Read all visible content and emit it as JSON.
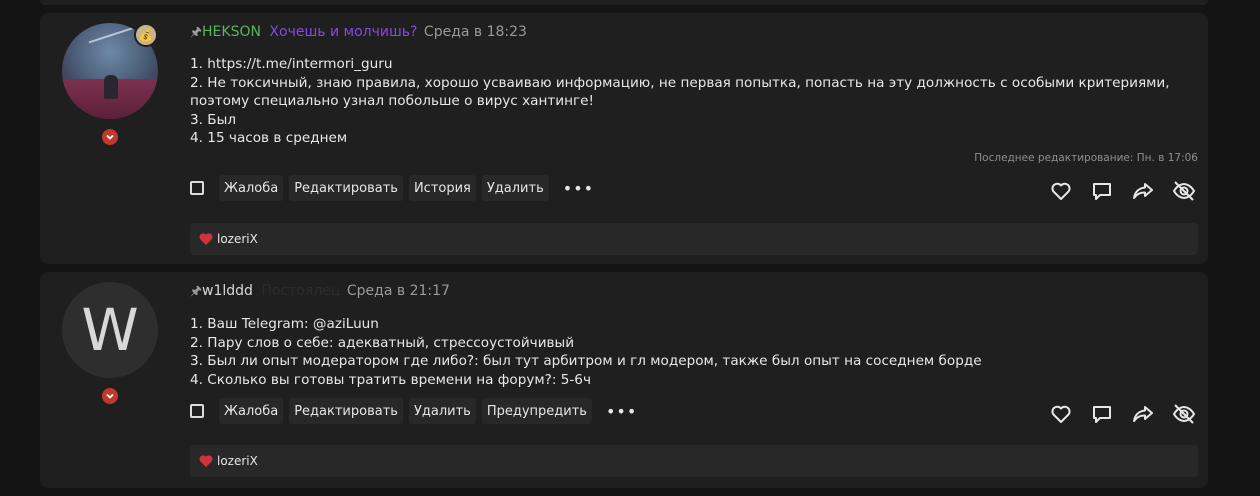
{
  "colors": {
    "accent_red": "#c0392b",
    "username_green": "#5ab55e",
    "title_purple": "#8b46e8"
  },
  "posts": [
    {
      "username": "HEKSON",
      "user_title": "Хочешь и молчишь?",
      "date": "Среда в 18:23",
      "avatar_letter": "",
      "lines": [
        "1. https://t.me/intermori_guru",
        "2. Не токсичный, знаю правила, хорошо усваиваю информацию, не первая попытка, попасть на эту должность с особыми критериями, поэтому специально узнал побольше о вирус хантинге!",
        "3. Был",
        "4. 15 часов в среднем"
      ],
      "edited": "Последнее редактирование: Пн. в 17:06",
      "actions": [
        "Жалоба",
        "Редактировать",
        "История",
        "Удалить"
      ],
      "more": "•••",
      "liked_by": "lozeriX"
    },
    {
      "username": "w1lddd",
      "user_title": "Постоялец",
      "date": "Среда в 21:17",
      "avatar_letter": "W",
      "lines": [
        "1. Ваш Telegram: @aziLuun",
        "2. Пару слов о себе: адекватный, стрессоустойчивый",
        "3. Был ли опыт модератором где либо?: был тут арбитром и гл модером, также был опыт на соседнем борде",
        "4. Сколько вы готовы тратить времени на форум?: 5-6ч"
      ],
      "actions": [
        "Жалоба",
        "Редактировать",
        "Удалить",
        "Предупредить"
      ],
      "more": "•••",
      "liked_by": "lozeriX"
    }
  ]
}
